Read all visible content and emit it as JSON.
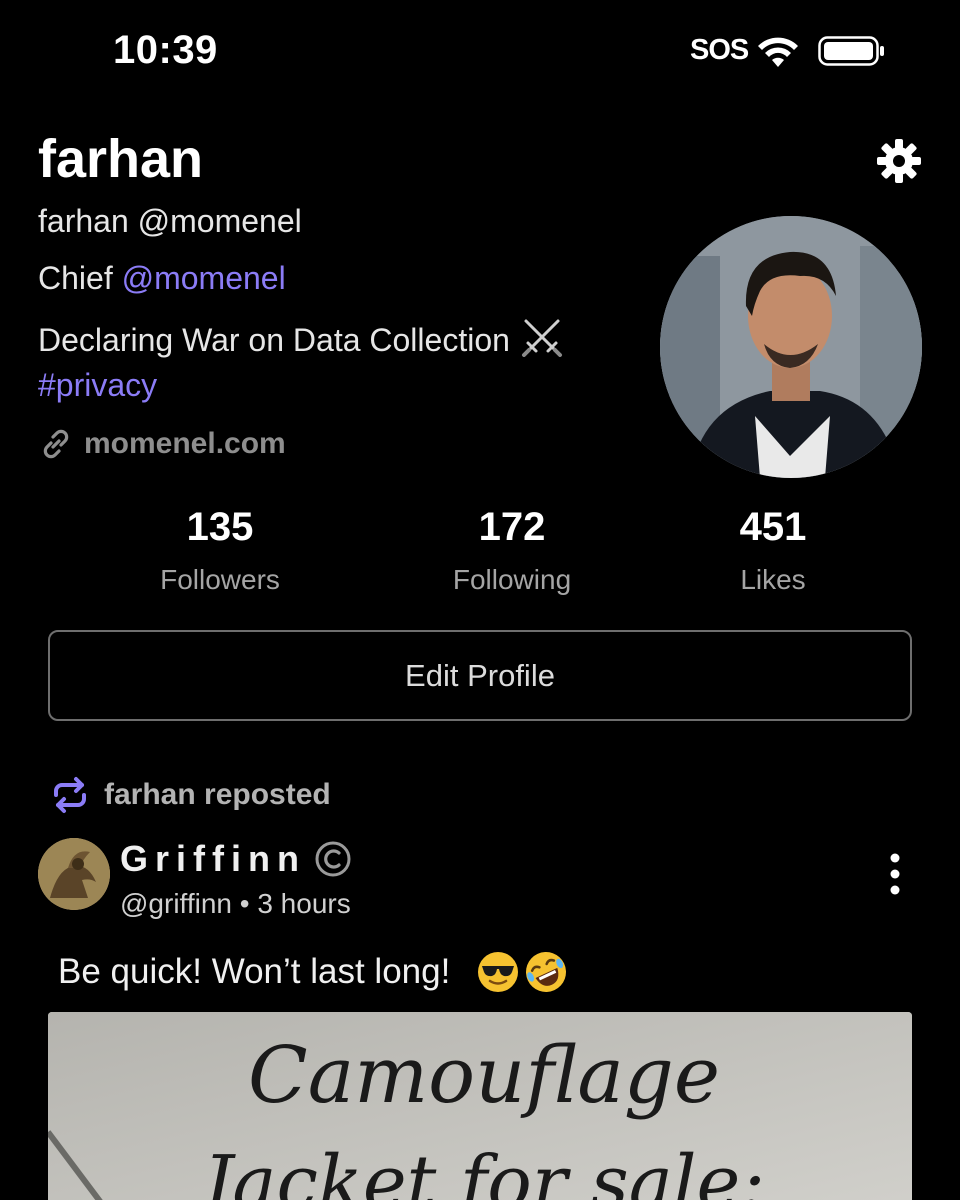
{
  "status_bar": {
    "time": "10:39",
    "carrier": "SOS"
  },
  "profile": {
    "name": "farhan",
    "handle_line": "farhan @momenel",
    "bio_prefix": "Chief ",
    "bio_mention": "@momenel",
    "bio_line2": "Declaring War on Data Collection",
    "hashtag": "#privacy",
    "link": "momenel.com"
  },
  "stats": {
    "followers": {
      "value": "135",
      "label": "Followers"
    },
    "following": {
      "value": "172",
      "label": "Following"
    },
    "likes": {
      "value": "451",
      "label": "Likes"
    }
  },
  "actions": {
    "edit_profile": "Edit Profile"
  },
  "post": {
    "repost_label": "farhan reposted",
    "author": "Griffinn",
    "meta": "@griffinn • 3 hours",
    "text": "Be quick!  Won’t last long!",
    "image_text_line1": "Camouflage",
    "image_text_line2": "Jacket for sale:"
  },
  "colors": {
    "accent": "#8b7cf6",
    "background": "#000000",
    "muted": "#a5a5a5"
  },
  "icons": [
    "wifi-icon",
    "battery-icon",
    "settings-gear-icon",
    "crossed-swords-icon",
    "link-icon",
    "repost-icon",
    "copyright-icon",
    "more-vertical-icon",
    "sunglasses-emoji-icon",
    "rofl-emoji-icon"
  ]
}
